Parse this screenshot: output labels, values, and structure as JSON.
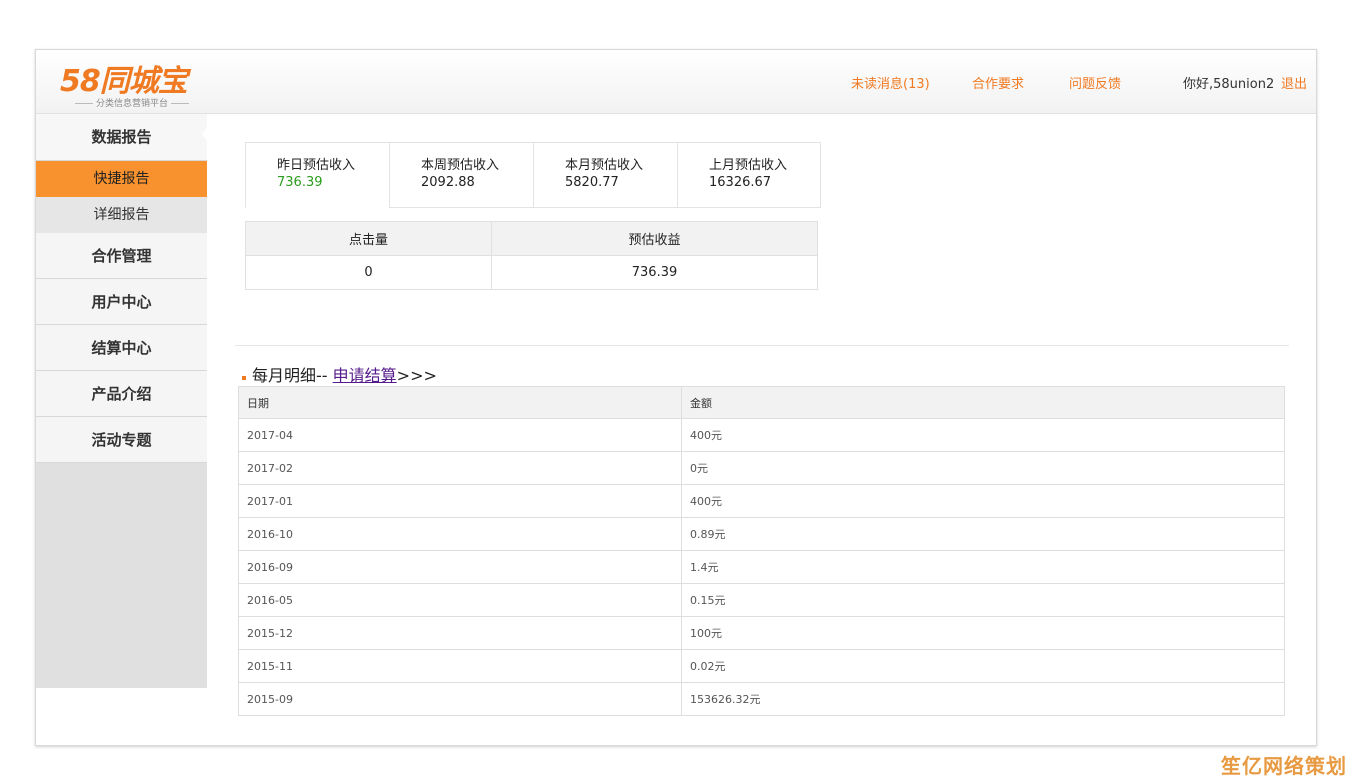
{
  "header": {
    "logo_text": "58同城宝",
    "logo_subtitle": "分类信息营销平台",
    "nav": {
      "unread": "未读消息(13)",
      "cooperation": "合作要求",
      "feedback": "问题反馈"
    },
    "greeting": "你好,58union2",
    "logout": "退出"
  },
  "sidebar": {
    "data_report": "数据报告",
    "quick_report": "快捷报告",
    "detail_report": "详细报告",
    "items": [
      "合作管理",
      "用户中心",
      "结算中心",
      "产品介绍",
      "活动专题"
    ]
  },
  "summary": [
    {
      "label": "昨日预估收入",
      "value": "736.39"
    },
    {
      "label": "本周预估收入",
      "value": "2092.88"
    },
    {
      "label": "本月预估收入",
      "value": "5820.77"
    },
    {
      "label": "上月预估收入",
      "value": "16326.67"
    }
  ],
  "summary_table": {
    "headers": [
      "点击量",
      "预估收益"
    ],
    "row": [
      "0",
      "736.39"
    ]
  },
  "monthly": {
    "title": "每月明细-- ",
    "apply_link": "申请结算",
    "arrows": ">>>",
    "headers": [
      "日期",
      "金额"
    ],
    "rows": [
      [
        "2017-04",
        "400元"
      ],
      [
        "2017-02",
        "0元"
      ],
      [
        "2017-01",
        "400元"
      ],
      [
        "2016-10",
        "0.89元"
      ],
      [
        "2016-09",
        "1.4元"
      ],
      [
        "2016-05",
        "0.15元"
      ],
      [
        "2015-12",
        "100元"
      ],
      [
        "2015-11",
        "0.02元"
      ],
      [
        "2015-09",
        "153626.32元"
      ]
    ]
  },
  "watermark": "笙亿网络策划",
  "colors": {
    "accent": "#f07a22",
    "active_tab": "#f7922e",
    "positive": "#2a9d1d"
  }
}
